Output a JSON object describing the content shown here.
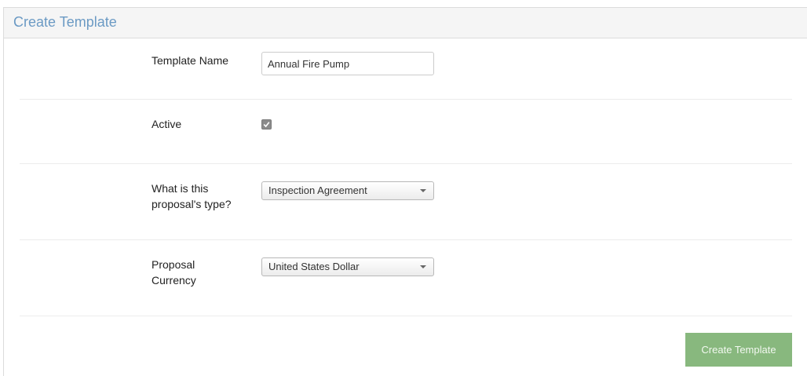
{
  "panel": {
    "title": "Create Template"
  },
  "form": {
    "template_name": {
      "label": "Template Name",
      "value": "Annual Fire Pump"
    },
    "active": {
      "label": "Active",
      "checked": true
    },
    "proposal_type": {
      "label_line1": "What is this",
      "label_line2": "proposal's type?",
      "selected": "Inspection Agreement"
    },
    "currency": {
      "label_line1": "Proposal",
      "label_line2": "Currency",
      "selected": "United States Dollar"
    },
    "submit_label": "Create Template"
  },
  "colors": {
    "title": "#6b9ac4",
    "submit_bg": "#88b87e",
    "checkbox": "#8a8a8a"
  },
  "icons": {
    "checkbox": "checkmark-icon",
    "select_caret": "caret-down-icon"
  }
}
